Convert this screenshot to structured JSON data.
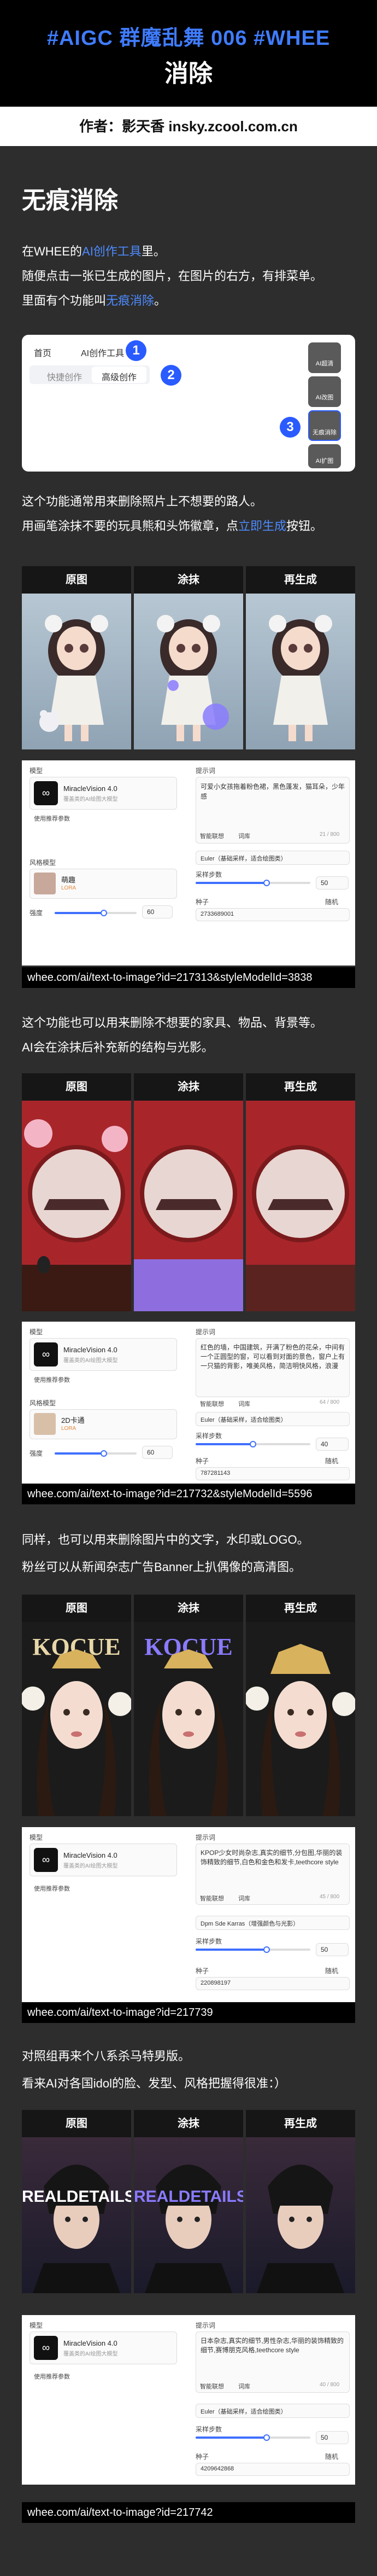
{
  "header": {
    "title_line1": "#AIGC 群魔乱舞 006  #WHEE",
    "title_line2": "消除",
    "author": "作者：影天香  insky.zcool.com.cn"
  },
  "intro": {
    "heading": "无痕消除",
    "p1_a": "在WHEE的",
    "p1_link": "AI创作工具",
    "p1_b": "里。",
    "p2": "随便点击一张已生成的图片，在图片的右方，有排菜单。",
    "p3_a": "里面有个功能叫",
    "p3_link": "无痕消除",
    "p3_b": "。"
  },
  "ui_card": {
    "tab_home": "首页",
    "tab_ai": "AI创作工具",
    "sub_quick": "快捷创作",
    "sub_advanced": "高级创作",
    "badge1": "1",
    "badge2": "2",
    "badge3": "3",
    "side_buttons": [
      "AI超清",
      "AI改图",
      "无痕消除",
      "AI扩图"
    ]
  },
  "section1": {
    "p1": "这个功能通常用来删除照片上不想要的路人。",
    "p2_a": "用画笔涂抹不要的玩具熊和头饰徽章，点",
    "p2_link": "立即生成",
    "p2_b": "按钮。",
    "col_orig": "原图",
    "col_mask": "涂抹",
    "col_regen": "再生成",
    "url": "whee.com/ai/text-to-image?id=217313&styleModelId=3838"
  },
  "section2": {
    "p1": "这个功能也可以用来删除不想要的家具、物品、背景等。",
    "p2": "AI会在涂抹后补充新的结构与光影。",
    "col_orig": "原图",
    "col_mask": "涂抹",
    "col_regen": "再生成",
    "url": "whee.com/ai/text-to-image?id=217732&styleModelId=5596"
  },
  "section3": {
    "p1": "同样，也可以用来删除图片中的文字，水印或LOGO。",
    "p2": "粉丝可以从新闻杂志广告Banner上扒偶像的高清图。",
    "col_orig": "原图",
    "col_mask": "涂抹",
    "col_regen": "再生成",
    "poster_text_orig": "KOCUE",
    "poster_text_mask": "KOCUE",
    "url": "whee.com/ai/text-to-image?id=217739"
  },
  "section4": {
    "p1": "对照组再来个八系杀马特男版。",
    "p2": "看来AI对各国idol的脸、发型、风格把握得很准：）",
    "col_orig": "原图",
    "col_mask": "涂抹",
    "col_regen": "再生成",
    "poster_text_orig": "REALDETAILS",
    "poster_text_mask": "REALDETAILS",
    "url": "whee.com/ai/text-to-image?id=217742"
  },
  "panel1": {
    "model_label": "模型",
    "model_name": "MiracleVision 4.0",
    "model_sub": "覆盖类的AI绘图大模型",
    "use_prompt": "使用推荐参数",
    "style_label": "风格模型",
    "style_name": "萌趣",
    "style_tag": "LORA",
    "strength_label": "强度",
    "strength_val": "60",
    "prompt_label": "提示词",
    "prompt_text": "可爱小女孩拖着粉色裙，黑色蓬发，猫耳朵，少年感",
    "btn_smart": "智能联想",
    "btn_dict": "词库",
    "counter": "21 / 800",
    "sampler": "Euler（基础采样，适合绘图类）",
    "steps_label": "采样步数",
    "steps_val": "50",
    "seed_label": "种子",
    "seed_random": "随机",
    "seed_val": "2733689001"
  },
  "panel2": {
    "model_label": "模型",
    "model_name": "MiracleVision 4.0",
    "model_sub": "覆盖类的AI绘图大模型",
    "use_prompt": "使用推荐参数",
    "style_label": "风格模型",
    "style_name": "2D卡通",
    "style_tag": "LORA",
    "strength_label": "强度",
    "strength_val": "60",
    "prompt_label": "提示词",
    "prompt_text": "红色的墙，中国建筑，开满了粉色的花朵，中间有一个正圆型的窗，可以看到对面的景色，窗户上有一只猫的背影，唯美风格，简洁明快风格，浪漫",
    "btn_smart": "智能联想",
    "btn_dict": "词库",
    "counter": "64 / 800",
    "sampler": "Euler（基础采样，适合绘图类）",
    "steps_label": "采样步数",
    "steps_val": "40",
    "seed_label": "种子",
    "seed_random": "随机",
    "seed_val": "787281143"
  },
  "panel3": {
    "model_label": "模型",
    "model_name": "MiracleVision 4.0",
    "model_sub": "覆盖类的AI绘图大模型",
    "use_prompt": "使用推荐参数",
    "prompt_label": "提示词",
    "prompt_text": "KPOP少女时尚杂志,真实的细节,分包图,华丽的装饰精致的细节,白色和金色和发卡,teethcore style",
    "btn_smart": "智能联想",
    "btn_dict": "词库",
    "counter": "45 / 800",
    "sampler": "Dpm Sde Karras（增强颜色与光影）",
    "steps_label": "采样步数",
    "steps_val": "50",
    "seed_label": "种子",
    "seed_random": "随机",
    "seed_val": "220898197"
  },
  "panel4": {
    "model_label": "模型",
    "model_name": "MiracleVision 4.0",
    "model_sub": "覆盖类的AI绘图大模型",
    "use_prompt": "使用推荐参数",
    "prompt_label": "提示词",
    "prompt_text": "日本杂志,真实的细节,男性杂志,华丽的装饰精致的细节,赛博朋克风格,teethcore style",
    "btn_smart": "智能联想",
    "btn_dict": "词库",
    "counter": "40 / 800",
    "sampler": "Euler（基础采样，适合绘图类）",
    "steps_label": "采样步数",
    "steps_val": "50",
    "seed_label": "种子",
    "seed_random": "随机",
    "seed_val": "4209642868"
  }
}
